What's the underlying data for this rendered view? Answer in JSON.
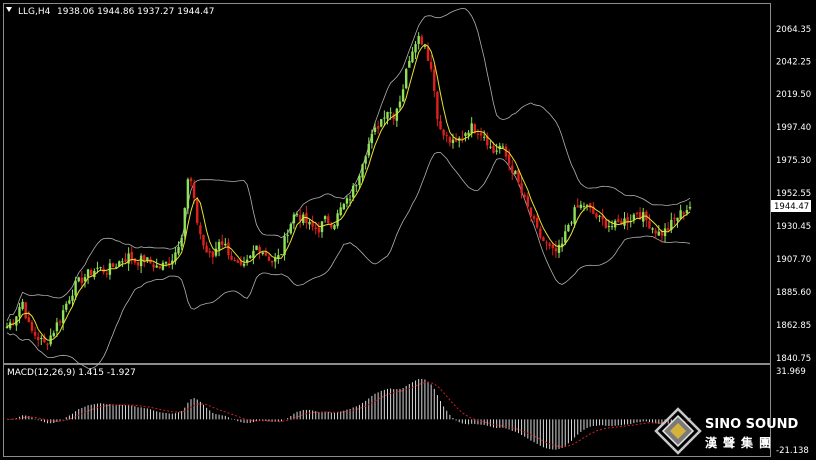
{
  "header": {
    "symbol": "LLG,H4",
    "ohlc": "1938.06 1944.86 1937.27 1944.47",
    "collapse_icon": "triangle-down-icon"
  },
  "price_axis": {
    "labels": [
      "2064.35",
      "2042.25",
      "2019.50",
      "1997.40",
      "1975.30",
      "1952.55",
      "1930.45",
      "1907.70",
      "1885.60",
      "1862.85",
      "1840.75"
    ],
    "current_price_label": "1944.47"
  },
  "macd": {
    "label": "MACD(12,26,9) 1.415 -1.927",
    "axis_top": "31.969",
    "axis_bottom": "-21.138"
  },
  "logo": {
    "name_en": "SINO SOUND",
    "name_cn": "漢聲集團",
    "icon": "diamond-logo-icon"
  },
  "colors": {
    "background": "#000000",
    "bull": "#8fe05a",
    "bear": "#e0201c",
    "ma_line": "#e8e230",
    "bollinger": "#b0b0b0",
    "macd_hist": "#d8d8d8",
    "macd_signal": "#d0201c"
  },
  "chart_data": {
    "type": "candlestick",
    "ylim": [
      1840.75,
      2064.35
    ],
    "close_path": [
      1862,
      1868,
      1880,
      1860,
      1855,
      1850,
      1858,
      1868,
      1880,
      1890,
      1895,
      1899,
      1902,
      1900,
      1903,
      1907,
      1910,
      1906,
      1908,
      1905,
      1902,
      1905,
      1910,
      1925,
      1968,
      1935,
      1915,
      1908,
      1922,
      1915,
      1905,
      1900,
      1908,
      1918,
      1912,
      1906,
      1910,
      1928,
      1940,
      1935,
      1930,
      1928,
      1935,
      1932,
      1942,
      1948,
      1960,
      1978,
      1990,
      2000,
      2010,
      2006,
      2020,
      2045,
      2060,
      2055,
      2035,
      1995,
      1990,
      1985,
      1992,
      1998,
      1996,
      1992,
      1980,
      1985,
      1975,
      1965,
      1950,
      1938,
      1925,
      1918,
      1912,
      1915,
      1932,
      1942,
      1945,
      1940,
      1935,
      1932,
      1930,
      1934,
      1935,
      1940,
      1936,
      1930,
      1925,
      1928,
      1935,
      1940,
      1944
    ]
  }
}
